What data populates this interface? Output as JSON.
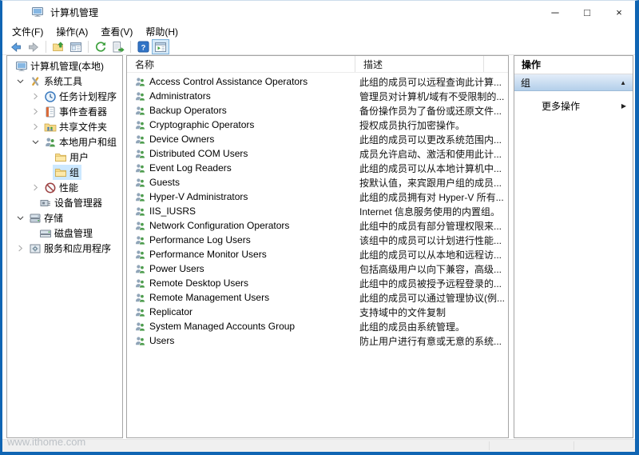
{
  "window": {
    "title": "计算机管理",
    "controls": {
      "minimize": "─",
      "maximize": "□",
      "close": "×"
    }
  },
  "menu": {
    "items": [
      {
        "id": "file",
        "label": "文件(F)"
      },
      {
        "id": "action",
        "label": "操作(A)"
      },
      {
        "id": "view",
        "label": "查看(V)"
      },
      {
        "id": "help",
        "label": "帮助(H)"
      }
    ]
  },
  "toolbar": {
    "items": [
      {
        "type": "button",
        "icon": "back-icon"
      },
      {
        "type": "button",
        "icon": "forward-icon",
        "disabled": true
      },
      {
        "type": "separator"
      },
      {
        "type": "button",
        "icon": "up-icon"
      },
      {
        "type": "button",
        "icon": "console-window-icon"
      },
      {
        "type": "separator"
      },
      {
        "type": "button",
        "icon": "refresh-icon"
      },
      {
        "type": "button",
        "icon": "export-list-icon"
      },
      {
        "type": "separator"
      },
      {
        "type": "button",
        "icon": "help-icon"
      },
      {
        "type": "button",
        "icon": "show-console-tree-icon",
        "active": true
      }
    ]
  },
  "tree": {
    "items": [
      {
        "label": "计算机管理(本地)",
        "level": 0,
        "icon": "computer",
        "chevron": null
      },
      {
        "label": "系统工具",
        "level": 1,
        "icon": "system-tools",
        "chevron": "expanded"
      },
      {
        "label": "任务计划程序",
        "level": 2,
        "icon": "task-scheduler",
        "chevron": "collapsed"
      },
      {
        "label": "事件查看器",
        "level": 2,
        "icon": "event-viewer",
        "chevron": "collapsed"
      },
      {
        "label": "共享文件夹",
        "level": 2,
        "icon": "shared-folders",
        "chevron": "collapsed"
      },
      {
        "label": "本地用户和组",
        "level": 2,
        "icon": "local-users-groups",
        "chevron": "expanded"
      },
      {
        "label": "用户",
        "level": 3,
        "icon": "folder",
        "chevron": null
      },
      {
        "label": "组",
        "level": 3,
        "icon": "folder",
        "chevron": null,
        "selected": true
      },
      {
        "label": "性能",
        "level": 2,
        "icon": "performance",
        "chevron": "collapsed"
      },
      {
        "label": "设备管理器",
        "level": 2,
        "icon": "device-manager",
        "chevron": null
      },
      {
        "label": "存储",
        "level": 1,
        "icon": "storage",
        "chevron": "expanded"
      },
      {
        "label": "磁盘管理",
        "level": 2,
        "icon": "disk-management",
        "chevron": null
      },
      {
        "label": "服务和应用程序",
        "level": 1,
        "icon": "services",
        "chevron": "collapsed"
      }
    ]
  },
  "list": {
    "columns": [
      "名称",
      "描述"
    ],
    "rows": [
      {
        "name": "Access Control Assistance Operators",
        "description": "此组的成员可以远程查询此计算..."
      },
      {
        "name": "Administrators",
        "description": "管理员对计算机/域有不受限制的..."
      },
      {
        "name": "Backup Operators",
        "description": "备份操作员为了备份或还原文件..."
      },
      {
        "name": "Cryptographic Operators",
        "description": "授权成员执行加密操作。"
      },
      {
        "name": "Device Owners",
        "description": "此组的成员可以更改系统范围内..."
      },
      {
        "name": "Distributed COM Users",
        "description": "成员允许启动、激活和使用此计..."
      },
      {
        "name": "Event Log Readers",
        "description": "此组的成员可以从本地计算机中..."
      },
      {
        "name": "Guests",
        "description": "按默认值，来宾跟用户组的成员..."
      },
      {
        "name": "Hyper-V Administrators",
        "description": "此组的成员拥有对 Hyper-V 所有..."
      },
      {
        "name": "IIS_IUSRS",
        "description": "Internet 信息服务使用的内置组。"
      },
      {
        "name": "Network Configuration Operators",
        "description": "此组中的成员有部分管理权限来..."
      },
      {
        "name": "Performance Log Users",
        "description": "该组中的成员可以计划进行性能..."
      },
      {
        "name": "Performance Monitor Users",
        "description": "此组的成员可以从本地和远程访..."
      },
      {
        "name": "Power Users",
        "description": "包括高级用户以向下兼容，高级..."
      },
      {
        "name": "Remote Desktop Users",
        "description": "此组中的成员被授予远程登录的..."
      },
      {
        "name": "Remote Management Users",
        "description": "此组的成员可以通过管理协议(例..."
      },
      {
        "name": "Replicator",
        "description": "支持域中的文件复制"
      },
      {
        "name": "System Managed Accounts Group",
        "description": "此组的成员由系统管理。"
      },
      {
        "name": "Users",
        "description": "防止用户进行有意或无意的系统..."
      }
    ]
  },
  "actions": {
    "title": "操作",
    "section_label": "组",
    "collapse_glyph": "▲",
    "more_label": "更多操作",
    "more_glyph": "▶"
  },
  "watermark": "www.ithome.com",
  "colors": {
    "window_border": "#1065b3",
    "tree_selection": "#cce8ff",
    "section_gradient_top": "#e3edf9",
    "section_gradient_bottom": "#b3cfea"
  }
}
